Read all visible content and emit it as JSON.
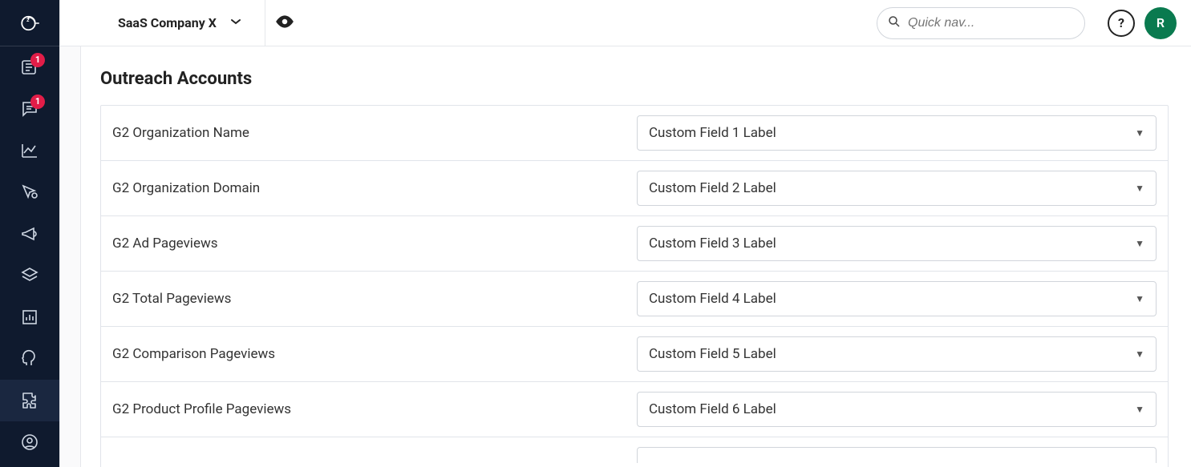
{
  "header": {
    "company_name": "SaaS Company X",
    "search_placeholder": "Quick nav...",
    "help_label": "?",
    "avatar_initial": "R"
  },
  "sidebar": {
    "badges": {
      "news": "1",
      "messages": "1"
    }
  },
  "page": {
    "title": "Outreach Accounts"
  },
  "mappings": [
    {
      "g2_field": "G2 Organization Name",
      "custom_field": "Custom Field 1 Label"
    },
    {
      "g2_field": "G2 Organization Domain",
      "custom_field": "Custom Field 2 Label"
    },
    {
      "g2_field": "G2 Ad Pageviews",
      "custom_field": "Custom Field 3 Label"
    },
    {
      "g2_field": "G2 Total Pageviews",
      "custom_field": "Custom Field 4 Label"
    },
    {
      "g2_field": "G2 Comparison Pageviews",
      "custom_field": "Custom Field 5 Label"
    },
    {
      "g2_field": "G2 Product Profile Pageviews",
      "custom_field": "Custom Field 6 Label"
    }
  ]
}
